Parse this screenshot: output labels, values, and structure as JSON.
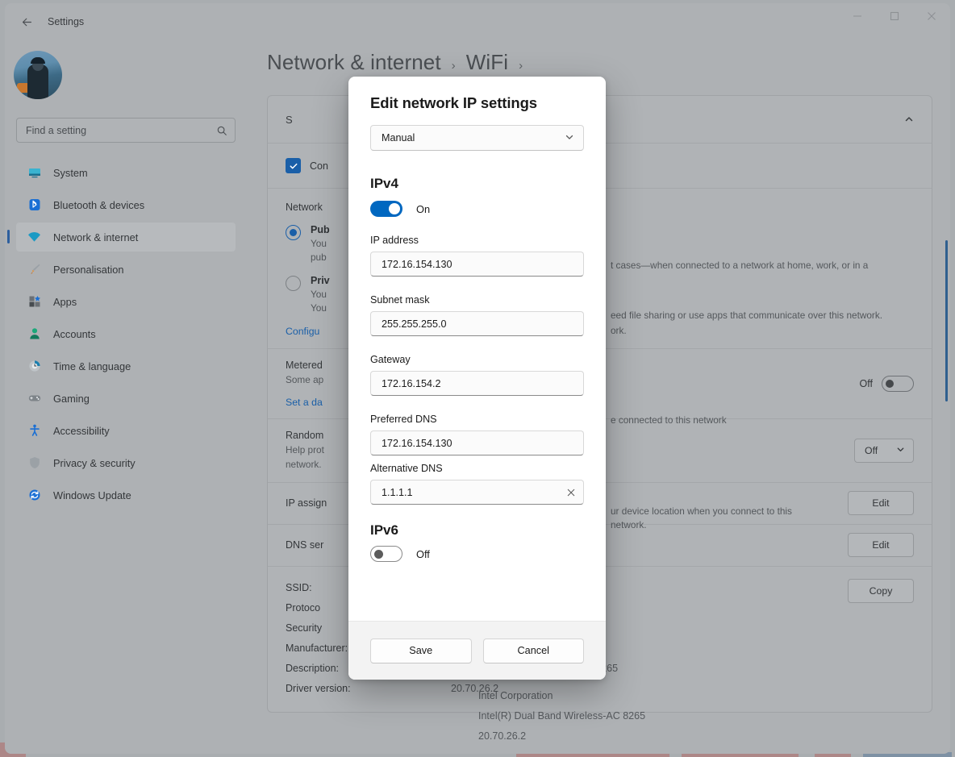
{
  "window": {
    "title": "Settings",
    "back_icon": "back-arrow-icon",
    "minimize": "minimize-icon",
    "maximize": "maximize-icon",
    "close": "close-icon"
  },
  "sidebar": {
    "search": {
      "placeholder": "Find a setting",
      "icon": "search-icon"
    },
    "items": [
      {
        "label": "System",
        "icon": "monitor-icon",
        "active": false
      },
      {
        "label": "Bluetooth & devices",
        "icon": "bluetooth-icon",
        "active": false
      },
      {
        "label": "Network & internet",
        "icon": "wifi-icon",
        "active": true
      },
      {
        "label": "Personalisation",
        "icon": "brush-icon",
        "active": false
      },
      {
        "label": "Apps",
        "icon": "apps-icon",
        "active": false
      },
      {
        "label": "Accounts",
        "icon": "person-icon",
        "active": false
      },
      {
        "label": "Time & language",
        "icon": "clock-icon",
        "active": false
      },
      {
        "label": "Gaming",
        "icon": "gamepad-icon",
        "active": false
      },
      {
        "label": "Accessibility",
        "icon": "accessibility-icon",
        "active": false
      },
      {
        "label": "Privacy & security",
        "icon": "shield-icon",
        "active": false
      },
      {
        "label": "Windows Update",
        "icon": "update-icon",
        "active": false
      }
    ]
  },
  "page": {
    "breadcrumb_1": "Network & internet",
    "breadcrumb_sep_1": "›",
    "breadcrumb_2": "WiFi",
    "breadcrumb_sep_2": "›"
  },
  "card": {
    "section_title": "S",
    "section_chevron": "chevron-up-icon",
    "connect_checkbox_label": "Con",
    "network_profile_heading": "Network",
    "profiles": [
      {
        "title": "Pub",
        "selected": true,
        "desc_line1": "You",
        "desc_line2": "pub",
        "desc_right_1": "t cases—when connected to a network at home, work, or in a"
      },
      {
        "title": "Priv",
        "selected": false,
        "desc_line1": "You",
        "desc_line2": "You",
        "desc_right_1": "eed file sharing or use apps that communicate over this network.",
        "desc_right_2": "ork."
      }
    ],
    "configure_link": "Configu",
    "metered": {
      "title": "Metered",
      "desc_left": "Some ap",
      "desc_right": "e connected to this network",
      "toggle_label": "Off",
      "toggle_state": "off"
    },
    "data_limit_link": "Set a da",
    "random": {
      "title": "Random",
      "desc_left_1": "Help prot",
      "desc_left_2": "network.",
      "desc_right_1": "ur device location when you connect to this",
      "desc_right_2": "network.",
      "combo_value": "Off",
      "combo_icon": "chevron-down-icon"
    },
    "ip_assignment": {
      "title": "IP assign",
      "button": "Edit"
    },
    "dns_server": {
      "title": "DNS ser",
      "button": "Edit"
    },
    "properties": {
      "copy_button": "Copy",
      "rows": [
        {
          "key": "SSID:",
          "value": ""
        },
        {
          "key": "Protoco",
          "value": ""
        },
        {
          "key": "Security",
          "value": ""
        },
        {
          "key": "Manufacturer:",
          "value": "Intel Corporation"
        },
        {
          "key": "Description:",
          "value": "Intel(R) Dual Band Wireless-AC 8265"
        },
        {
          "key": "Driver version:",
          "value": "20.70.26.2"
        }
      ]
    }
  },
  "dialog": {
    "title": "Edit network IP settings",
    "mode": {
      "value": "Manual",
      "icon": "chevron-down-icon"
    },
    "ipv4": {
      "heading": "IPv4",
      "toggle_state": "on",
      "toggle_label": "On",
      "fields": [
        {
          "label": "IP address",
          "value": "172.16.154.130",
          "clear": false
        },
        {
          "label": "Subnet mask",
          "value": "255.255.255.0",
          "clear": false
        },
        {
          "label": "Gateway",
          "value": "172.16.154.2",
          "clear": false
        },
        {
          "label": "Preferred DNS",
          "value": "172.16.154.130",
          "clear": false
        },
        {
          "label": "Alternative DNS",
          "value": "1.1.1.1",
          "clear": true,
          "clear_icon": "clear-x-icon"
        }
      ]
    },
    "ipv6": {
      "heading": "IPv6",
      "toggle_state": "off",
      "toggle_label": "Off"
    },
    "save_label": "Save",
    "cancel_label": "Cancel"
  },
  "colors": {
    "accent": "#0067c0",
    "accent_dark": "#1a5fa8",
    "window_bg": "#aeb1b4",
    "dialog_bg": "#ffffff",
    "dialog_footer_bg": "#f3f3f3"
  }
}
